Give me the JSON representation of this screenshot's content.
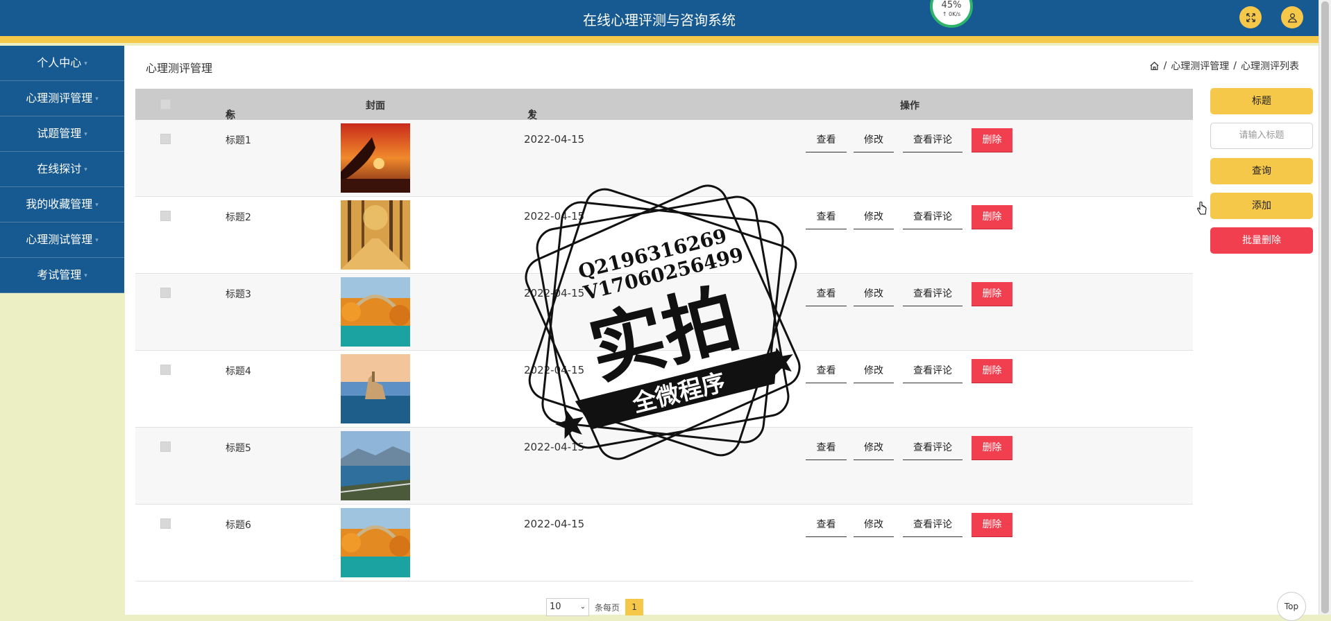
{
  "header": {
    "title": "在线心理评测与咨询系统",
    "gauge_value": "45%",
    "gauge_speed": "↑ 0K/s",
    "fullscreen_icon": "expand-icon",
    "user_icon": "user-icon",
    "accent": "#f6c84a",
    "bar_color": "#175a92"
  },
  "sidebar": {
    "items": [
      {
        "label": "个人中心"
      },
      {
        "label": "心理测评管理"
      },
      {
        "label": "试题管理"
      },
      {
        "label": "在线探讨"
      },
      {
        "label": "我的收藏管理"
      },
      {
        "label": "心理测试管理"
      },
      {
        "label": "考试管理"
      }
    ],
    "caret": "▾"
  },
  "page": {
    "title": "心理测评管理",
    "breadcrumb": [
      "心理测评管理",
      "心理测评列表"
    ],
    "separator": "/"
  },
  "table": {
    "columns": [
      "标题",
      "封面",
      "发布时间",
      "操作"
    ],
    "sort_icon": "⇕",
    "rows": [
      {
        "title": "标题1",
        "date": "2022-04-15"
      },
      {
        "title": "标题2",
        "date": "2022-04-15"
      },
      {
        "title": "标题3",
        "date": "2022-04-15"
      },
      {
        "title": "标题4",
        "date": "2022-04-15"
      },
      {
        "title": "标题5",
        "date": "2022-04-15"
      },
      {
        "title": "标题6",
        "date": "2022-04-15"
      }
    ],
    "actions": {
      "view": "查看",
      "edit": "修改",
      "comments": "查看评论",
      "delete": "删除"
    }
  },
  "search_panel": {
    "field_label": "标题",
    "input_placeholder": "请输入标题",
    "query": "查询",
    "add": "添加",
    "batch_delete": "批量删除"
  },
  "pager": {
    "page_size": "10",
    "per_page_label": "条每页",
    "current_page": "1"
  },
  "top_button": "Top",
  "watermark": {
    "line1": "Q2196316269",
    "line2": "V17060256499",
    "main": "实拍",
    "banner": "全微程序"
  }
}
